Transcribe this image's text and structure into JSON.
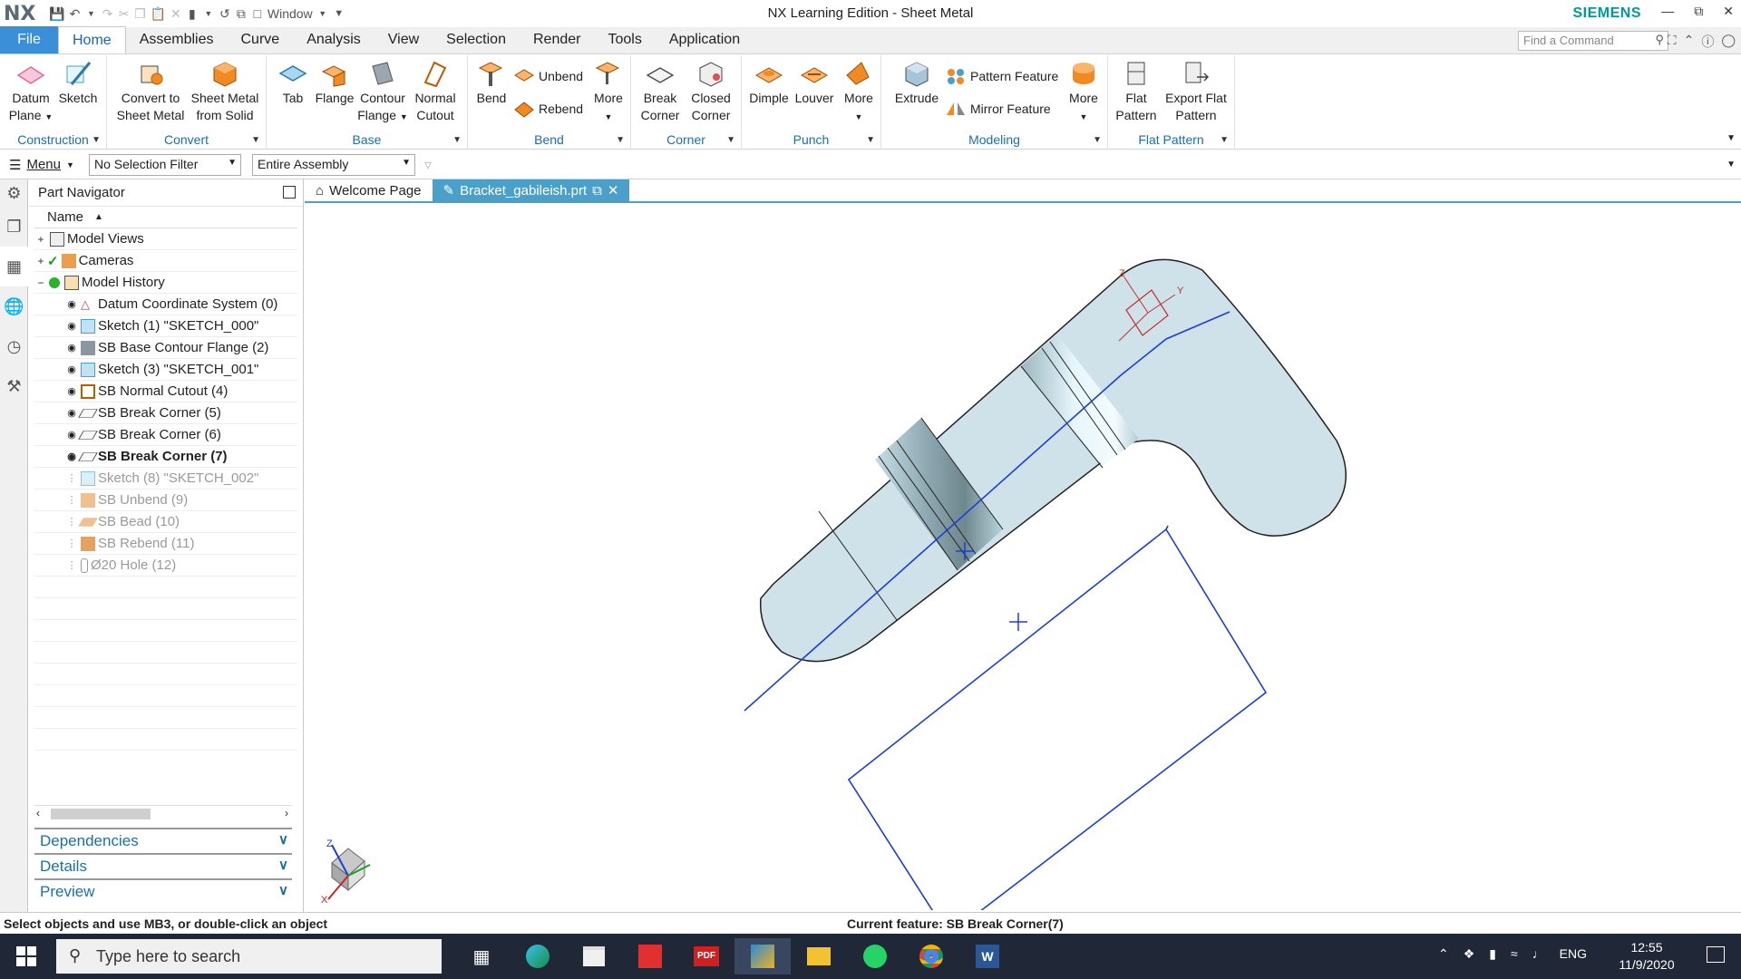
{
  "titlebar": {
    "logo": "NX",
    "window_menu": "Window",
    "title": "NX Learning Edition - Sheet Metal",
    "brand": "SIEMENS"
  },
  "menubar": {
    "tabs": [
      {
        "label": "File"
      },
      {
        "label": "Home"
      },
      {
        "label": "Assemblies"
      },
      {
        "label": "Curve"
      },
      {
        "label": "Analysis"
      },
      {
        "label": "View"
      },
      {
        "label": "Selection"
      },
      {
        "label": "Render"
      },
      {
        "label": "Tools"
      },
      {
        "label": "Application"
      }
    ],
    "find_command_placeholder": "Find a Command"
  },
  "ribbon": {
    "construction": {
      "label": "Construction",
      "datum_plane_1": "Datum",
      "datum_plane_2": "Plane",
      "sketch": "Sketch"
    },
    "convert": {
      "label": "Convert",
      "convert_1": "Convert to",
      "convert_2": "Sheet Metal",
      "smfs_1": "Sheet Metal",
      "smfs_2": "from Solid"
    },
    "base": {
      "label": "Base",
      "tab": "Tab",
      "flange": "Flange",
      "contour_1": "Contour",
      "contour_2": "Flange",
      "cutout_1": "Normal",
      "cutout_2": "Cutout"
    },
    "bend": {
      "label": "Bend",
      "bend": "Bend",
      "unbend": "Unbend",
      "rebend": "Rebend",
      "more": "More"
    },
    "corner": {
      "label": "Corner",
      "break_1": "Break",
      "break_2": "Corner",
      "closed_1": "Closed",
      "closed_2": "Corner"
    },
    "punch": {
      "label": "Punch",
      "dimple": "Dimple",
      "louver": "Louver",
      "more": "More"
    },
    "modeling": {
      "label": "Modeling",
      "extrude": "Extrude",
      "pattern": "Pattern Feature",
      "mirror": "Mirror Feature",
      "more": "More"
    },
    "flat_pattern": {
      "label": "Flat Pattern",
      "flat_1": "Flat",
      "flat_2": "Pattern",
      "export_1": "Export Flat",
      "export_2": "Pattern"
    }
  },
  "selection_bar": {
    "menu": "Menu",
    "filter": "No Selection Filter",
    "scope": "Entire Assembly"
  },
  "part_navigator": {
    "title": "Part Navigator",
    "column": "Name",
    "rows": [
      {
        "label": "Model Views"
      },
      {
        "label": "Cameras"
      },
      {
        "label": "Model History"
      },
      {
        "label": "Datum Coordinate System (0)"
      },
      {
        "label": "Sketch (1) \"SKETCH_000\""
      },
      {
        "label": "SB Base Contour Flange (2)"
      },
      {
        "label": "Sketch (3) \"SKETCH_001\""
      },
      {
        "label": "SB Normal Cutout (4)"
      },
      {
        "label": "SB Break Corner (5)"
      },
      {
        "label": "SB Break Corner (6)"
      },
      {
        "label": "SB Break Corner (7)"
      },
      {
        "label": "Sketch (8) \"SKETCH_002\""
      },
      {
        "label": "SB Unbend (9)"
      },
      {
        "label": "SB Bead (10)"
      },
      {
        "label": "SB Rebend (11)"
      },
      {
        "label": "Ø20 Hole (12)"
      }
    ],
    "accordions": [
      "Dependencies",
      "Details",
      "Preview"
    ]
  },
  "doc_tabs": [
    {
      "label": "Welcome Page"
    },
    {
      "label": "Bracket_gabileish.prt"
    }
  ],
  "viewport": {
    "triad_z": "Z",
    "triad_x": "X",
    "csys_z": "Z",
    "csys_y": "Y"
  },
  "status": {
    "prompt": "Select objects and use MB3, or double-click an object",
    "current_feature": "Current feature: SB Break Corner(7)"
  },
  "taskbar": {
    "search_placeholder": "Type here to search",
    "lang": "ENG",
    "time": "12:55",
    "date": "11/9/2020"
  }
}
